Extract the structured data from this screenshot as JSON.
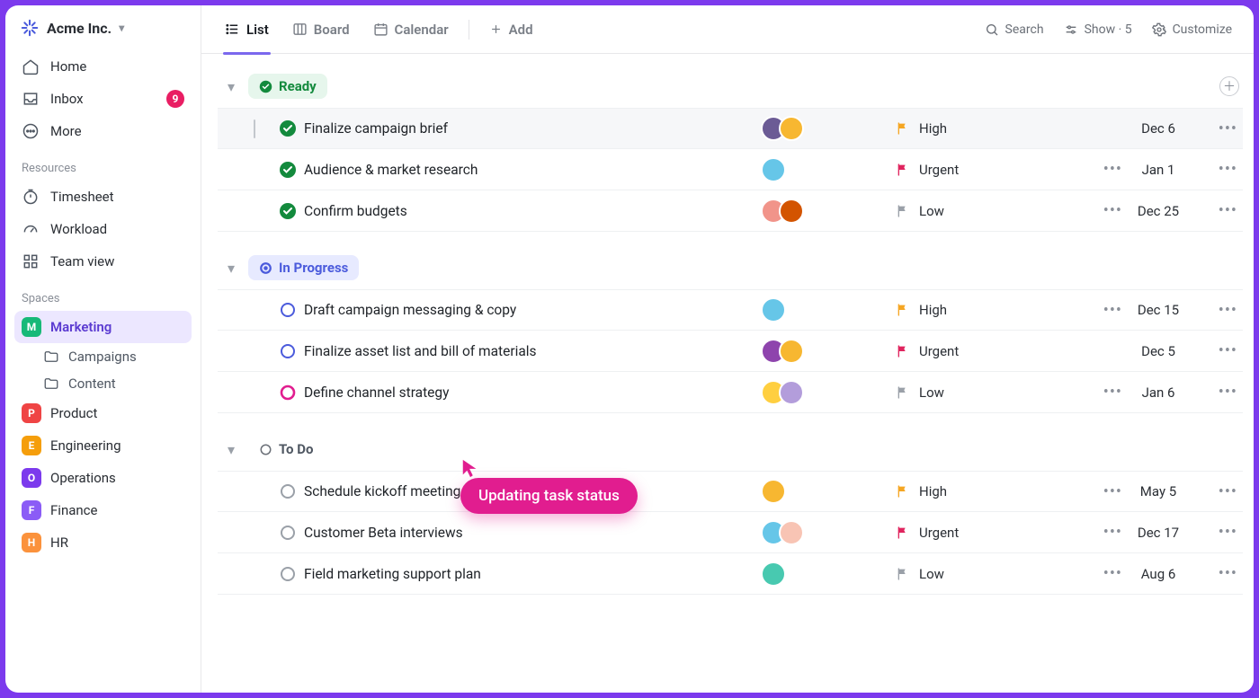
{
  "workspace": {
    "name": "Acme Inc."
  },
  "sidebar": {
    "nav": {
      "home": "Home",
      "inbox": "Inbox",
      "inbox_count": "9",
      "more": "More"
    },
    "sections": {
      "resources_label": "Resources",
      "spaces_label": "Spaces"
    },
    "resources": {
      "timesheet": "Timesheet",
      "workload": "Workload",
      "teamview": "Team view"
    },
    "spaces": [
      {
        "initial": "M",
        "label": "Marketing",
        "color": "#17b978",
        "active": true
      },
      {
        "initial": "P",
        "label": "Product",
        "color": "#ef4444"
      },
      {
        "initial": "E",
        "label": "Engineering",
        "color": "#f59e0b"
      },
      {
        "initial": "O",
        "label": "Operations",
        "color": "#7c3aed"
      },
      {
        "initial": "F",
        "label": "Finance",
        "color": "#8b5cf6"
      },
      {
        "initial": "H",
        "label": "HR",
        "color": "#fb923c"
      }
    ],
    "subspaces": {
      "campaigns": "Campaigns",
      "content": "Content"
    }
  },
  "topbar": {
    "views": {
      "list": "List",
      "board": "Board",
      "calendar": "Calendar"
    },
    "add": "Add",
    "search": "Search",
    "show": "Show · 5",
    "customize": "Customize"
  },
  "groups": {
    "ready": {
      "label": "Ready"
    },
    "progress": {
      "label": "In Progress"
    },
    "todo": {
      "label": "To Do"
    }
  },
  "tasks": {
    "ready": [
      {
        "title": "Finalize campaign brief",
        "priority": "High",
        "date": "Dec 6",
        "avatars": [
          "#6b5b95",
          "#f7b731"
        ],
        "selected": true,
        "sub": false
      },
      {
        "title": "Audience & market research",
        "priority": "Urgent",
        "date": "Jan 1",
        "avatars": [
          "#66c6e8"
        ],
        "selected": false,
        "sub": true
      },
      {
        "title": "Confirm budgets",
        "priority": "Low",
        "date": "Dec 25",
        "avatars": [
          "#f1948a",
          "#d35400"
        ],
        "selected": false,
        "sub": true
      }
    ],
    "progress": [
      {
        "title": "Draft campaign messaging & copy",
        "priority": "High",
        "date": "Dec 15",
        "avatars": [
          "#66c6e8"
        ],
        "sub": true
      },
      {
        "title": "Finalize asset list and bill of materials",
        "priority": "Urgent",
        "date": "Dec 5",
        "avatars": [
          "#8e44ad",
          "#f7b731"
        ],
        "sub": false
      },
      {
        "title": "Define channel strategy",
        "priority": "Low",
        "date": "Jan 6",
        "avatars": [
          "#ffcf40",
          "#b39ddb"
        ],
        "sub": true,
        "highlight": true
      }
    ],
    "todo": [
      {
        "title": "Schedule kickoff meeting",
        "priority": "High",
        "date": "May 5",
        "avatars": [
          "#f7b731"
        ],
        "sub": true
      },
      {
        "title": "Customer Beta interviews",
        "priority": "Urgent",
        "date": "Dec 17",
        "avatars": [
          "#66c6e8",
          "#f8c4b4"
        ],
        "sub": true
      },
      {
        "title": "Field marketing support plan",
        "priority": "Low",
        "date": "Aug 6",
        "avatars": [
          "#48c9b0"
        ],
        "sub": true
      }
    ]
  },
  "priority_colors": {
    "High": "#f5a623",
    "Urgent": "#e0245e",
    "Low": "#9aa0a8"
  },
  "tooltip": "Updating task status"
}
